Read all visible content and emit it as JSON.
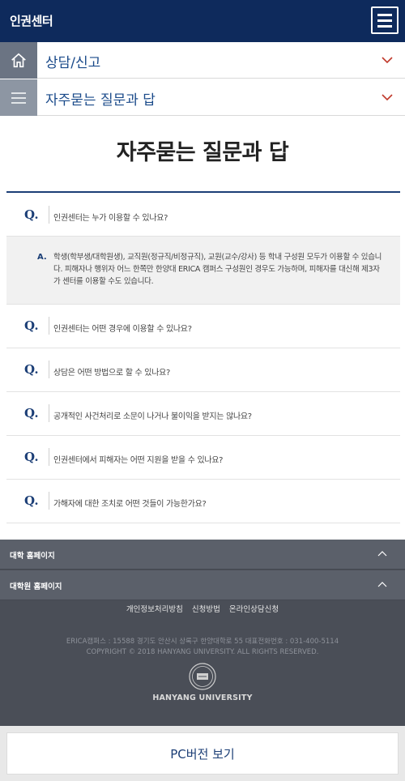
{
  "header": {
    "title": "인권센터"
  },
  "nav": {
    "row1": {
      "label": "상담/신고"
    },
    "row2": {
      "label": "자주묻는 질문과 답"
    }
  },
  "page": {
    "title": "자주묻는 질문과 답"
  },
  "faq": {
    "q_mark": "Q.",
    "a_mark": "A.",
    "items": [
      {
        "question": "인권센터는 누가 이용할 수 있나요?"
      },
      {
        "question": "인권센터는 어떤 경우에 이용할 수 있나요?"
      },
      {
        "question": "상담은 어떤 방법으로 할 수 있나요?"
      },
      {
        "question": "공개적인 사건처리로 소문이 나거나 불이익을 받지는 않나요?"
      },
      {
        "question": "인권센터에서 피해자는 어떤 지원을 받을 수 있나요?"
      },
      {
        "question": "가해자에 대한 조치로 어떤 것들이 가능한가요?"
      }
    ],
    "answer": "학생(학부생/대학원생), 교직원(정규직/비정규직), 교원(교수/강사) 등 학내 구성원 모두가 이용할 수 있습니다. 피해자나 행위자 어느 한쪽만 한양대 ERICA 캠퍼스 구성원인 경우도 가능하며, 피해자를 대신해 제3자가 센터를 이용할 수도 있습니다."
  },
  "footer": {
    "links": [
      {
        "label": "대학 홈페이지"
      },
      {
        "label": "대학원 홈페이지"
      }
    ],
    "menu": [
      "개인정보처리방침",
      "신청방법",
      "온라인상담신청"
    ],
    "address": "ERICA캠퍼스 : 15588 경기도 안산시 상록구 한양대학로 55 대표전화번호 : 031-400-5114",
    "copyright": "COPYRIGHT © 2018 HANYANG UNIVERSITY. ALL RIGHTS RESERVED.",
    "university": "HANYANG UNIVERSITY"
  },
  "pc_view": {
    "label": "PC버전 보기"
  },
  "colors": {
    "header_bg": "#0e2a5c",
    "accent": "#1b3e76",
    "chevron": "#c0392b",
    "footer_bg": "#4a4e57"
  }
}
